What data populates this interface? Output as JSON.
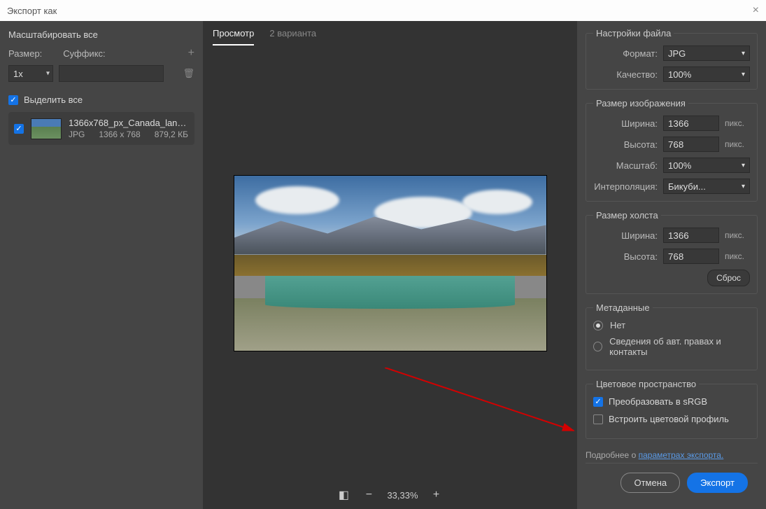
{
  "title": "Экспорт как",
  "left": {
    "scale_all": "Масштабировать все",
    "size_label": "Размер:",
    "suffix_label": "Суффикс:",
    "size_value": "1x",
    "select_all": "Выделить все",
    "asset": {
      "name": "1366x768_px_Canada_landscap...",
      "format": "JPG",
      "dims": "1366 x 768",
      "size": "879,2 КБ"
    }
  },
  "center": {
    "tab_preview": "Просмотр",
    "tab_2up": "2 варианта",
    "zoom": "33,33%"
  },
  "right": {
    "file_settings": "Настройки файла",
    "format_label": "Формат:",
    "format_value": "JPG",
    "quality_label": "Качество:",
    "quality_value": "100%",
    "image_size": "Размер изображения",
    "width_label": "Ширина:",
    "width_value": "1366",
    "height_label": "Высота:",
    "height_value": "768",
    "scale_label": "Масштаб:",
    "scale_value": "100%",
    "resample_label": "Интерполяция:",
    "resample_value": "Бикуби...",
    "px": "пикс.",
    "canvas_size": "Размер холста",
    "canvas_width": "1366",
    "canvas_height": "768",
    "reset": "Сброс",
    "metadata": "Метаданные",
    "meta_none": "Нет",
    "meta_copyright": "Сведения об авт. правах и контакты",
    "color_space": "Цветовое пространство",
    "convert_srgb": "Преобразовать в sRGB",
    "embed_profile": "Встроить цветовой профиль",
    "more_about": "Подробнее о",
    "export_params": "параметрах экспорта."
  },
  "footer": {
    "cancel": "Отмена",
    "export": "Экспорт"
  }
}
